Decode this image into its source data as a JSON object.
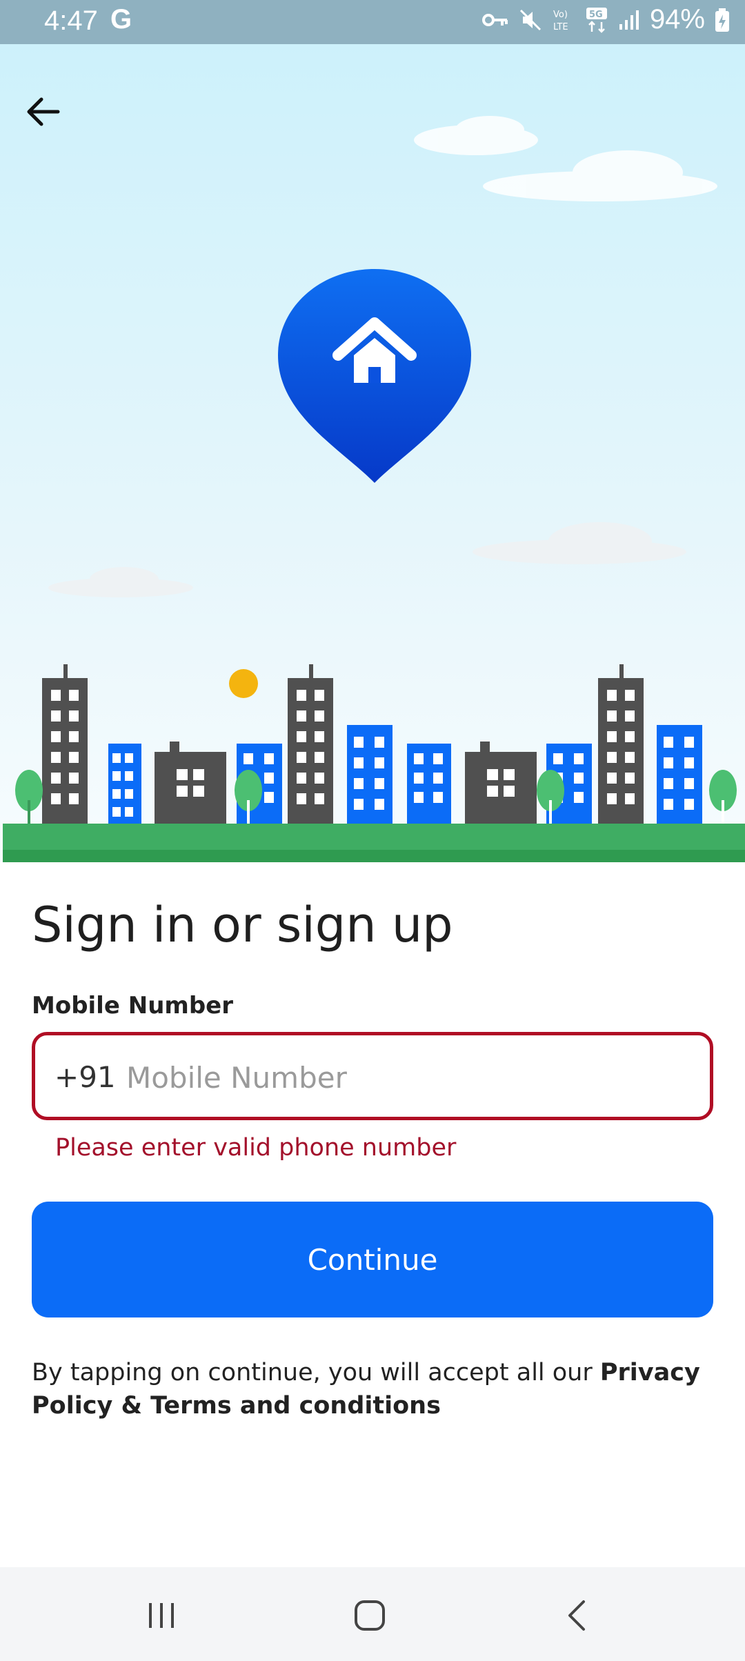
{
  "status_bar": {
    "time": "4:47",
    "google_badge": "G",
    "battery_percent": "94%",
    "icons": [
      "vpn-key-icon",
      "mute-icon",
      "volte-icon",
      "5g-icon",
      "signal-icon",
      "battery-charging-icon"
    ]
  },
  "header": {
    "back_icon": "arrow-left-icon"
  },
  "hero": {
    "logo_icon": "home-location-pin-icon"
  },
  "form": {
    "title": "Sign in or sign up",
    "mobile_label": "Mobile Number",
    "country_code": "+91",
    "mobile_value": "",
    "mobile_placeholder": "Mobile Number",
    "error_text": "Please enter valid phone number",
    "continue_label": "Continue"
  },
  "terms": {
    "prefix": "By tapping on continue, you will accept all our ",
    "link": "Privacy Policy & Terms and conditions"
  },
  "colors": {
    "primary": "#0b6cf7",
    "error": "#b00d24",
    "building_dark": "#505050",
    "ground": "#3fad63"
  },
  "nav_bar": {
    "items": [
      "recents-icon",
      "home-icon",
      "back-icon"
    ]
  }
}
